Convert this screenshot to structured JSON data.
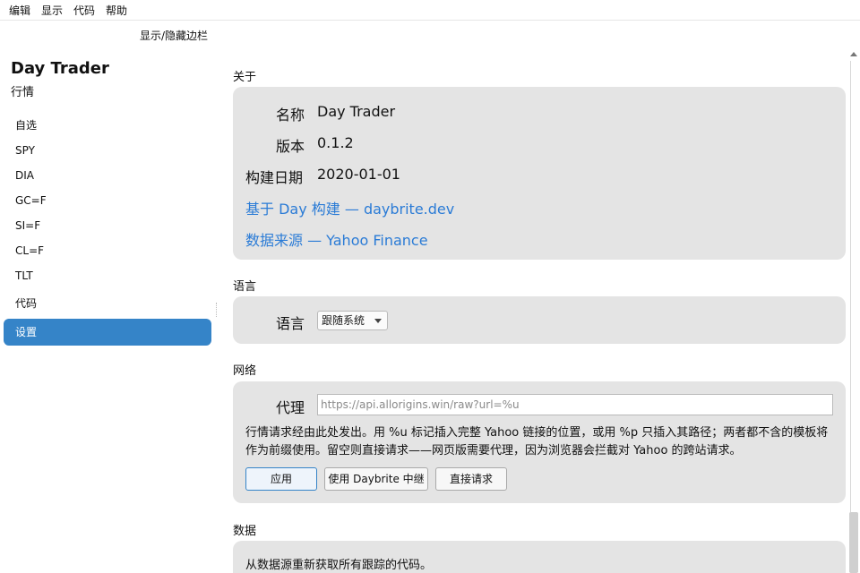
{
  "menu": [
    "编辑",
    "显示",
    "代码",
    "帮助"
  ],
  "toggle_sidebar_label": "显示/隐藏边栏",
  "sidebar": {
    "title": "Day Trader",
    "subtitle": "行情",
    "items": [
      {
        "label": "自选"
      },
      {
        "label": "SPY"
      },
      {
        "label": "DIA"
      },
      {
        "label": "GC=F"
      },
      {
        "label": "SI=F"
      },
      {
        "label": "CL=F"
      },
      {
        "label": "TLT"
      },
      {
        "label": "代码"
      },
      {
        "label": "设置",
        "active": true
      }
    ]
  },
  "about": {
    "section_title": "关于",
    "name_label": "名称",
    "name_value": "Day Trader",
    "version_label": "版本",
    "version_value": "0.1.2",
    "build_date_label": "构建日期",
    "build_date_value": "2020-01-01",
    "link_built_on": "基于 Day 构建 — daybrite.dev",
    "link_data_source": "数据来源 — Yahoo Finance"
  },
  "language": {
    "section_title": "语言",
    "label": "语言",
    "selected": "跟随系统"
  },
  "network": {
    "section_title": "网络",
    "proxy_label": "代理",
    "proxy_placeholder": "https://api.allorigins.win/raw?url=%u",
    "proxy_value": "",
    "help_text": "行情请求经由此处发出。用 %u 标记插入完整 Yahoo 链接的位置，或用 %p 只插入其路径；两者都不含的模板将作为前缀使用。留空则直接请求——网页版需要代理，因为浏览器会拦截对 Yahoo 的跨站请求。",
    "apply_button": "应用",
    "daybrite_button": "使用 Daybrite 中继",
    "direct_button": "直接请求"
  },
  "data": {
    "section_title": "数据",
    "description": "从数据源重新获取所有跟踪的代码。"
  },
  "colors": {
    "accent": "#3584c8",
    "link": "#2a7bd6",
    "card_bg": "#e4e4e4"
  }
}
